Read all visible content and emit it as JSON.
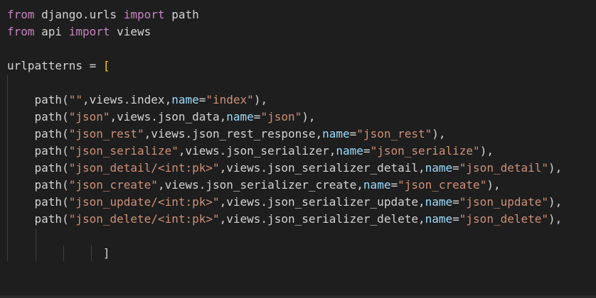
{
  "colors": {
    "background": "#1e1e1e",
    "keyword": "#c586c0",
    "default": "#d4d4d4",
    "string": "#ce9178",
    "param": "#9cdcfe",
    "bracket": "#ffd700",
    "guide": "#404040"
  },
  "code": {
    "lines": [
      {
        "tokens": [
          {
            "t": "from",
            "c": "keyword"
          },
          {
            "t": " django.urls ",
            "c": "default"
          },
          {
            "t": "import",
            "c": "keyword"
          },
          {
            "t": " path",
            "c": "default"
          }
        ]
      },
      {
        "tokens": [
          {
            "t": "from",
            "c": "keyword"
          },
          {
            "t": " api ",
            "c": "default"
          },
          {
            "t": "import",
            "c": "keyword"
          },
          {
            "t": " views",
            "c": "default"
          }
        ]
      },
      {
        "tokens": []
      },
      {
        "tokens": [
          {
            "t": "urlpatterns = ",
            "c": "default"
          },
          {
            "t": "[",
            "c": "bracket"
          }
        ]
      },
      {
        "tokens": []
      },
      {
        "tokens": [
          {
            "t": "    path(",
            "c": "default"
          },
          {
            "t": "\"\"",
            "c": "string"
          },
          {
            "t": ",views.index,",
            "c": "default"
          },
          {
            "t": "name",
            "c": "param"
          },
          {
            "t": "=",
            "c": "default"
          },
          {
            "t": "\"index\"",
            "c": "string"
          },
          {
            "t": "),",
            "c": "default"
          }
        ]
      },
      {
        "tokens": [
          {
            "t": "    path(",
            "c": "default"
          },
          {
            "t": "\"json\"",
            "c": "string"
          },
          {
            "t": ",views.json_data,",
            "c": "default"
          },
          {
            "t": "name",
            "c": "param"
          },
          {
            "t": "=",
            "c": "default"
          },
          {
            "t": "\"json\"",
            "c": "string"
          },
          {
            "t": "),",
            "c": "default"
          }
        ]
      },
      {
        "tokens": [
          {
            "t": "    path(",
            "c": "default"
          },
          {
            "t": "\"json_rest\"",
            "c": "string"
          },
          {
            "t": ",views.json_rest_response,",
            "c": "default"
          },
          {
            "t": "name",
            "c": "param"
          },
          {
            "t": "=",
            "c": "default"
          },
          {
            "t": "\"json_rest\"",
            "c": "string"
          },
          {
            "t": "),",
            "c": "default"
          }
        ]
      },
      {
        "tokens": [
          {
            "t": "    path(",
            "c": "default"
          },
          {
            "t": "\"json_serialize\"",
            "c": "string"
          },
          {
            "t": ",views.json_serializer,",
            "c": "default"
          },
          {
            "t": "name",
            "c": "param"
          },
          {
            "t": "=",
            "c": "default"
          },
          {
            "t": "\"json_serialize\"",
            "c": "string"
          },
          {
            "t": "),",
            "c": "default"
          }
        ]
      },
      {
        "tokens": [
          {
            "t": "    path(",
            "c": "default"
          },
          {
            "t": "\"json_detail/<int:pk>\"",
            "c": "string"
          },
          {
            "t": ",views.json_serializer_detail,",
            "c": "default"
          },
          {
            "t": "name",
            "c": "param"
          },
          {
            "t": "=",
            "c": "default"
          },
          {
            "t": "\"json_detail\"",
            "c": "string"
          },
          {
            "t": "),",
            "c": "default"
          }
        ]
      },
      {
        "tokens": [
          {
            "t": "    path(",
            "c": "default"
          },
          {
            "t": "\"json_create\"",
            "c": "string"
          },
          {
            "t": ",views.json_serializer_create,",
            "c": "default"
          },
          {
            "t": "name",
            "c": "param"
          },
          {
            "t": "=",
            "c": "default"
          },
          {
            "t": "\"json_create\"",
            "c": "string"
          },
          {
            "t": "),",
            "c": "default"
          }
        ]
      },
      {
        "tokens": [
          {
            "t": "    path(",
            "c": "default"
          },
          {
            "t": "\"json_update/<int:pk>\"",
            "c": "string"
          },
          {
            "t": ",views.json_serializer_update,",
            "c": "default"
          },
          {
            "t": "name",
            "c": "param"
          },
          {
            "t": "=",
            "c": "default"
          },
          {
            "t": "\"json_update\"",
            "c": "string"
          },
          {
            "t": "),",
            "c": "default"
          }
        ]
      },
      {
        "tokens": [
          {
            "t": "    path(",
            "c": "default"
          },
          {
            "t": "\"json_delete/<int:pk>\"",
            "c": "string"
          },
          {
            "t": ",views.json_serializer_delete,",
            "c": "default"
          },
          {
            "t": "name",
            "c": "param"
          },
          {
            "t": "=",
            "c": "default"
          },
          {
            "t": "\"json_delete\"",
            "c": "string"
          },
          {
            "t": "),",
            "c": "default"
          }
        ]
      },
      {
        "tokens": []
      },
      {
        "tokens": [
          {
            "t": "              ",
            "c": "default"
          },
          {
            "t": "]",
            "c": "default"
          }
        ]
      }
    ]
  }
}
